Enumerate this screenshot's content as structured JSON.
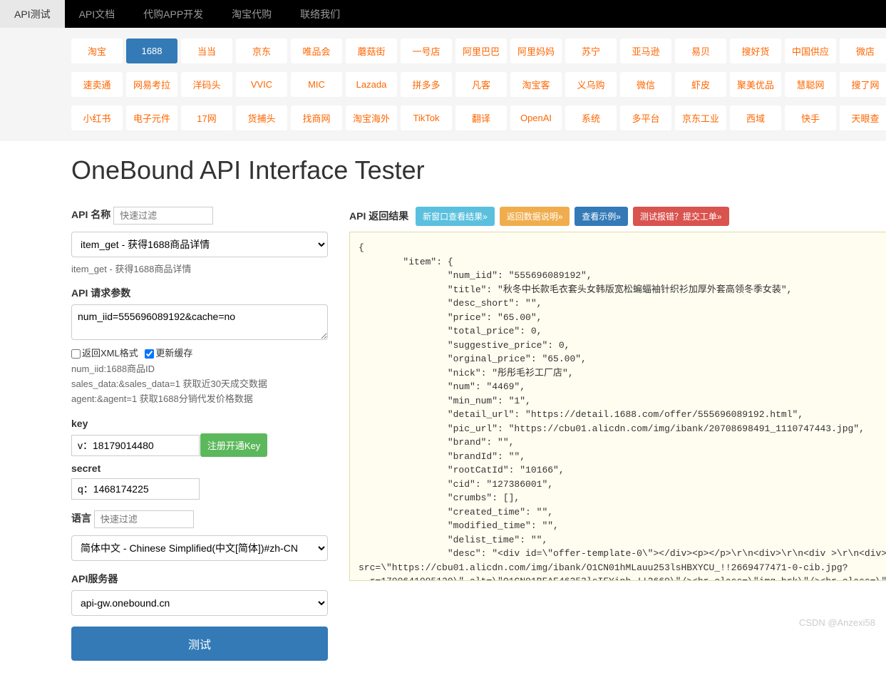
{
  "nav": {
    "items": [
      {
        "label": "API测试",
        "active": true
      },
      {
        "label": "API文档",
        "active": false
      },
      {
        "label": "代购APP开发",
        "active": false
      },
      {
        "label": "淘宝代购",
        "active": false
      },
      {
        "label": "联络我们",
        "active": false
      }
    ]
  },
  "platforms": {
    "row1": [
      "淘宝",
      "1688",
      "当当",
      "京东",
      "唯品会",
      "蘑菇街",
      "一号店",
      "阿里巴巴",
      "阿里妈妈",
      "苏宁",
      "亚马逊",
      "易贝",
      "搜好货",
      "中国供应",
      "微店"
    ],
    "row2": [
      "速卖通",
      "网易考拉",
      "洋码头",
      "VVIC",
      "MIC",
      "Lazada",
      "拼多多",
      "凡客",
      "淘宝客",
      "义乌购",
      "微信",
      "虾皮",
      "聚美优品",
      "慧聪网",
      "搜了网"
    ],
    "row3": [
      "小红书",
      "电子元件",
      "17网",
      "货捕头",
      "找商网",
      "淘宝海外",
      "TikTok",
      "翻译",
      "OpenAI",
      "系统",
      "多平台",
      "京东工业",
      "西域",
      "快手",
      "天眼查"
    ],
    "active": "1688"
  },
  "page": {
    "title": "OneBound API Interface Tester"
  },
  "form": {
    "api_name_label": "API 名称",
    "api_name_filter_placeholder": "快速过滤",
    "api_select_value": "item_get - 获得1688商品详情",
    "api_desc": "item_get - 获得1688商品详情",
    "api_params_label": "API 请求参数",
    "api_params_value": "num_iid=555696089192&cache=no",
    "xml_checkbox_label": "返回XML格式",
    "cache_checkbox_label": "更新缓存",
    "params_desc": [
      "num_iid:1688商品ID",
      "sales_data:&sales_data=1 获取近30天成交数据",
      "agent:&agent=1 获取1688分销代发价格数据"
    ],
    "key_label": "key",
    "key_value": "v：18179014480",
    "key_register_btn": "注册开通Key",
    "secret_label": "secret",
    "secret_value": "q：1468174225",
    "lang_label": "语言",
    "lang_filter_placeholder": "快速过滤",
    "lang_select_value": "简体中文 - Chinese Simplified(中文[简体])#zh-CN",
    "server_label": "API服务器",
    "server_value": "api-gw.onebound.cn",
    "test_btn": "测试"
  },
  "result": {
    "label": "API 返回结果",
    "btn_new_window": "新窗口查看结果»",
    "btn_data_desc": "返回数据说明»",
    "btn_example": "查看示例»",
    "btn_report": "测试报错？提交工单»",
    "json_text": "{\n        \"item\": {\n                \"num_iid\": \"555696089192\",\n                \"title\": \"秋冬中长款毛衣套头女韩版宽松蝙蝠袖针织衫加厚外套高领冬季女装\",\n                \"desc_short\": \"\",\n                \"price\": \"65.00\",\n                \"total_price\": 0,\n                \"suggestive_price\": 0,\n                \"orginal_price\": \"65.00\",\n                \"nick\": \"彤彤毛衫工厂店\",\n                \"num\": \"4469\",\n                \"min_num\": \"1\",\n                \"detail_url\": \"https://detail.1688.com/offer/555696089192.html\",\n                \"pic_url\": \"https://cbu01.alicdn.com/img/ibank/20708698491_1110747443.jpg\",\n                \"brand\": \"\",\n                \"brandId\": \"\",\n                \"rootCatId\": \"10166\",\n                \"cid\": \"127386001\",\n                \"crumbs\": [],\n                \"created_time\": \"\",\n                \"modified_time\": \"\",\n                \"delist_time\": \"\",\n                \"desc\": \"<div id=\\\"offer-template-0\\\"></div><p></p>\\r\\n<div>\\r\\n<div >\\r\\n<div><img \nsrc=\\\"https://cbu01.alicdn.com/img/ibank/O1CN01hMLauu253lsHBXYCU_!!2669477471-0-cib.jpg?\n__r=1700641095120\\\" alt=\\\"O1CN01BFAF46253lsIFYinh_!!2669\\\"/><br class=\\\"img-brk\\\"/><br class=\\\"img"
  },
  "watermark": "CSDN @Anzexi58"
}
